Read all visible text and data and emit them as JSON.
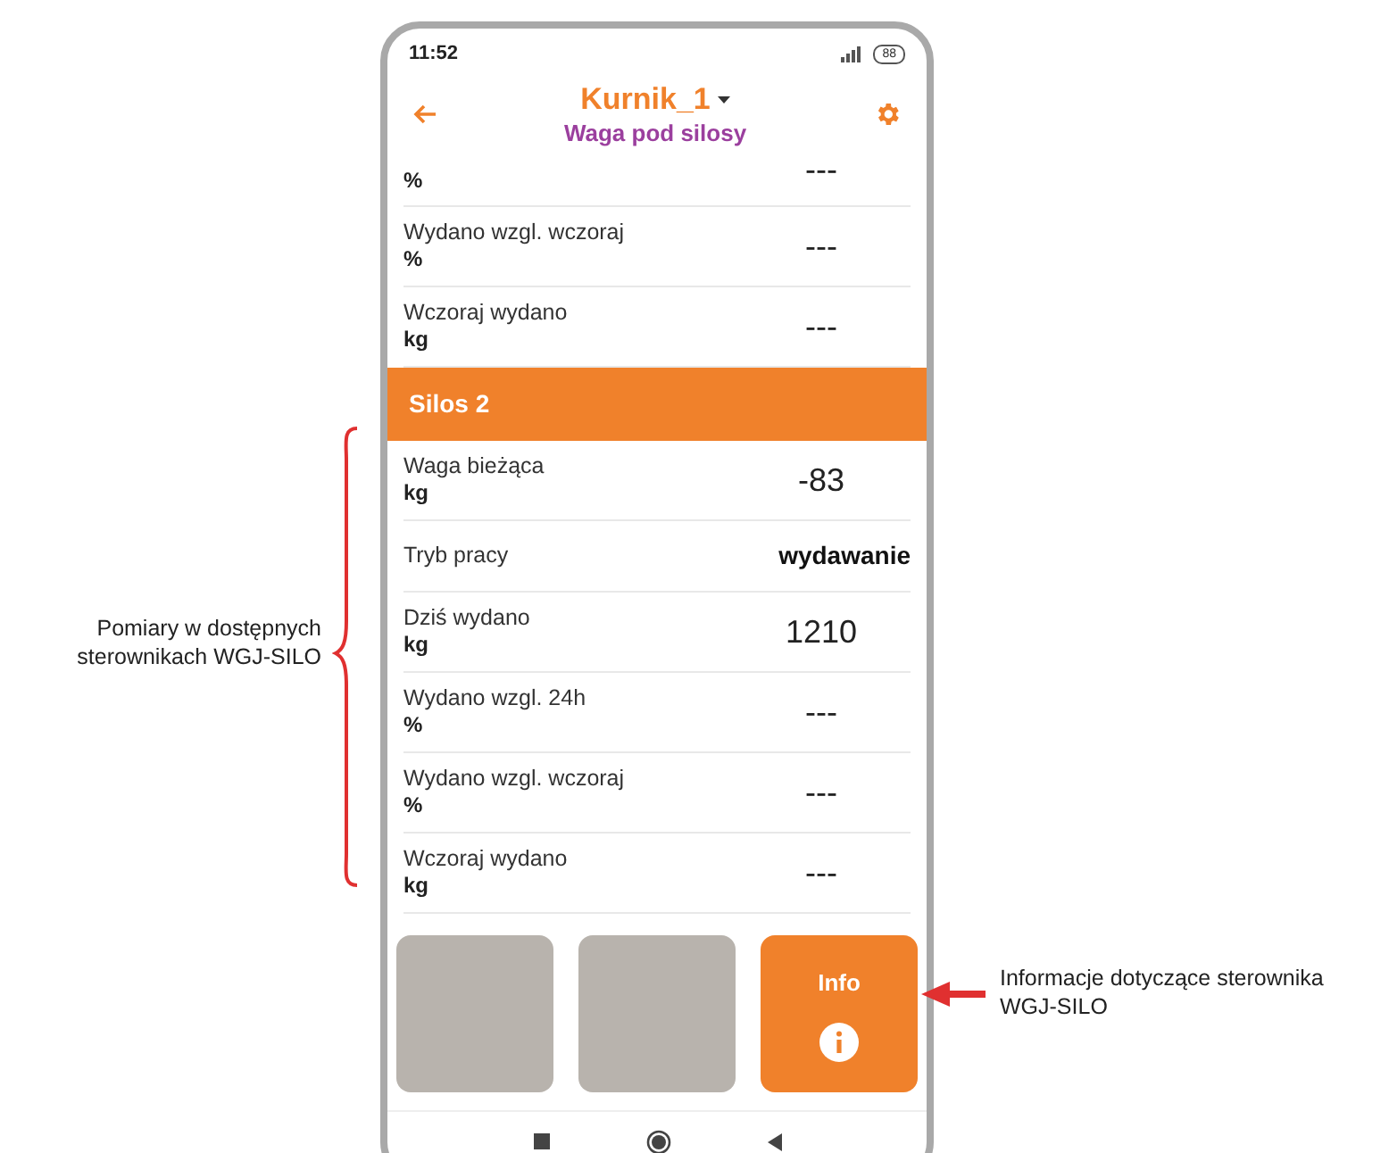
{
  "status_bar": {
    "time": "11:52",
    "battery": "88"
  },
  "header": {
    "title": "Kurnik_1",
    "subtitle": "Waga pod silosy"
  },
  "sections": [
    {
      "rows": [
        {
          "kind": "partial",
          "unit": "%",
          "value": "---"
        },
        {
          "kind": "measure",
          "label": "Wydano wzgl. wczoraj",
          "unit": "%",
          "value": "---"
        },
        {
          "kind": "measure",
          "label": "Wczoraj wydano",
          "unit": "kg",
          "value": "---"
        }
      ]
    },
    {
      "title": "Silos 2",
      "rows": [
        {
          "kind": "measure",
          "label": "Waga bieżąca",
          "unit": "kg",
          "value": "-83"
        },
        {
          "kind": "status",
          "label": "Tryb pracy",
          "value": "wydawanie"
        },
        {
          "kind": "measure",
          "label": "Dziś wydano",
          "unit": "kg",
          "value": "1210"
        },
        {
          "kind": "measure",
          "label": "Wydano wzgl. 24h",
          "unit": "%",
          "value": "---"
        },
        {
          "kind": "measure",
          "label": "Wydano wzgl. wczoraj",
          "unit": "%",
          "value": "---"
        },
        {
          "kind": "measure",
          "label": "Wczoraj wydano",
          "unit": "kg",
          "value": "---"
        }
      ]
    }
  ],
  "tiles": [
    {
      "kind": "blank"
    },
    {
      "kind": "blank"
    },
    {
      "kind": "info",
      "label": "Info"
    }
  ],
  "annotations": [
    {
      "kind": "brace",
      "text": "Pomiary w dostępnych sterownikach WGJ-SILO"
    },
    {
      "kind": "arrow",
      "text": "Informacje dotyczące sterownika WGJ-SILO"
    }
  ]
}
